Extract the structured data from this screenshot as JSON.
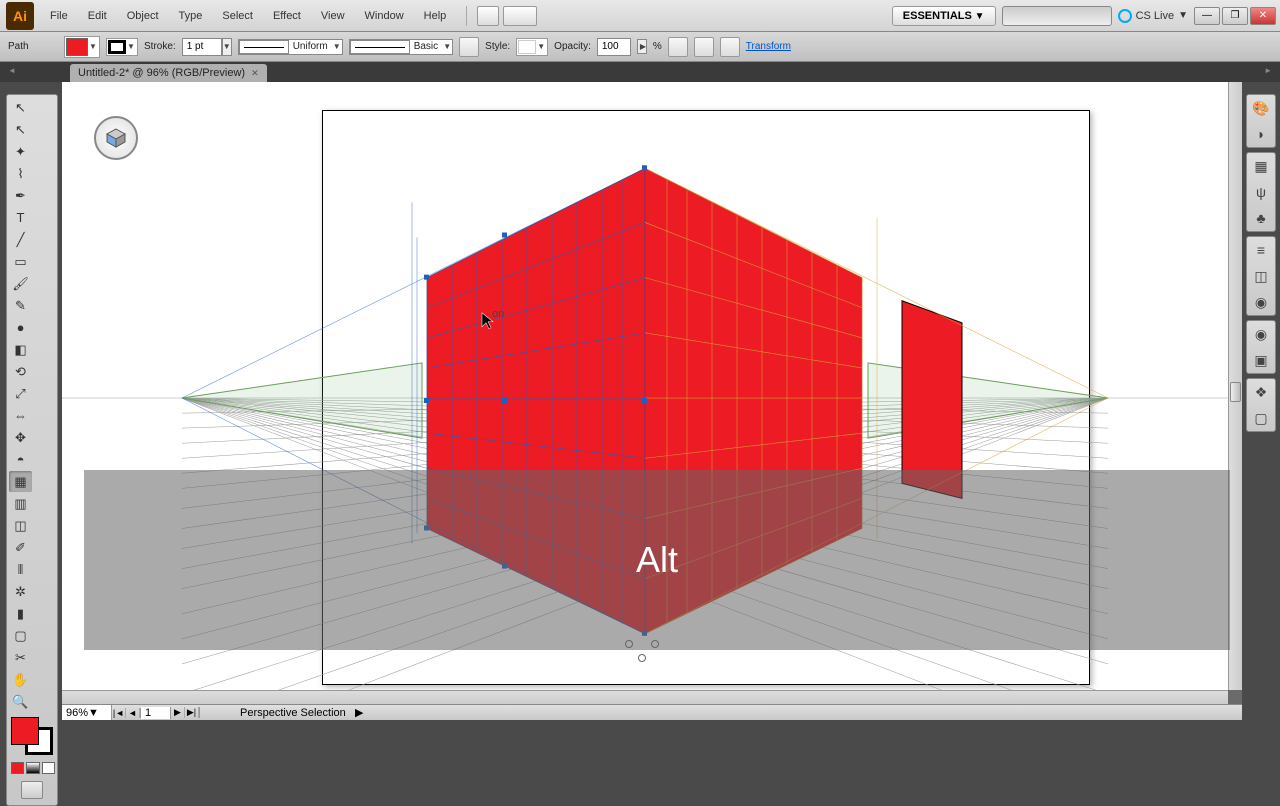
{
  "app": {
    "name": "Ai"
  },
  "menu": [
    "File",
    "Edit",
    "Object",
    "Type",
    "Select",
    "Effect",
    "View",
    "Window",
    "Help"
  ],
  "workspace_label": "ESSENTIALS",
  "cslive": "CS Live",
  "tab": {
    "title": "Untitled-2* @ 96% (RGB/Preview)"
  },
  "control": {
    "selection": "Path",
    "fill_color": "#ed1c24",
    "stroke_color": "#000000",
    "stroke_label": "Stroke:",
    "stroke_weight": "1 pt",
    "stroke_profile": "Uniform",
    "brush": "Basic",
    "style_label": "Style:",
    "opacity_label": "Opacity:",
    "opacity": "100",
    "opacity_unit": "%",
    "transform": "Transform"
  },
  "status": {
    "zoom": "96%",
    "page": "1",
    "tool": "Perspective Selection"
  },
  "overlay_key": "Alt",
  "colors": {
    "red": "#ed1c24"
  }
}
